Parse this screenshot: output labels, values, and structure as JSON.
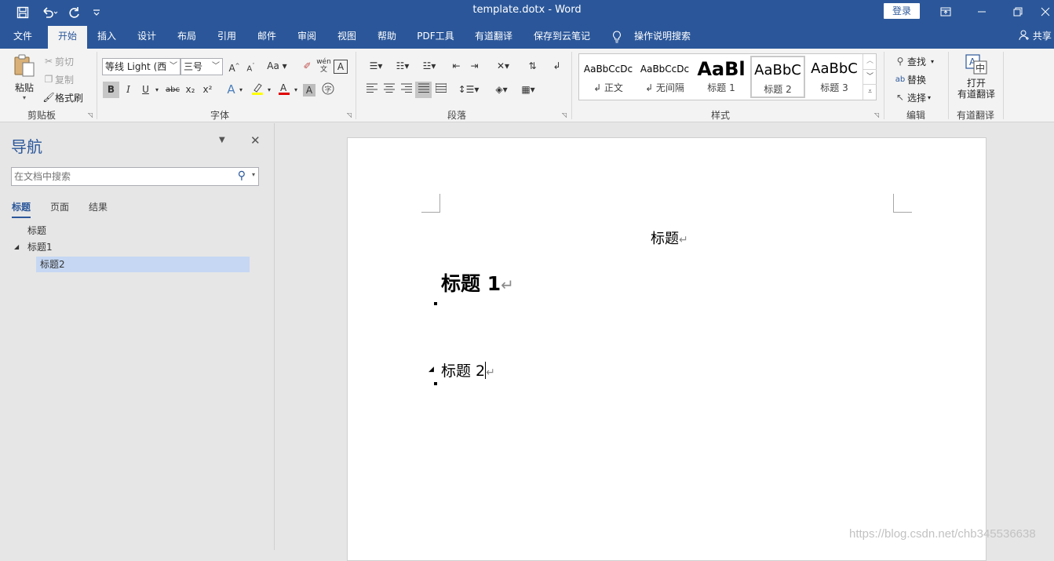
{
  "titlebar": {
    "doc_title": "template.dotx  -  Word",
    "login": "登录",
    "qat": {
      "save_icon": "save-icon",
      "undo_icon": "undo-icon",
      "redo_icon": "redo-icon",
      "customize_icon": "customize-qat-icon"
    },
    "window": {
      "ribbon_display_icon": "ribbon-display-icon",
      "minimize_icon": "minimize-icon",
      "restore_icon": "restore-icon",
      "close_icon": "close-icon"
    }
  },
  "tabs": [
    "文件",
    "开始",
    "插入",
    "设计",
    "布局",
    "引用",
    "邮件",
    "审阅",
    "视图",
    "帮助",
    "PDF工具",
    "有道翻译",
    "保存到云笔记"
  ],
  "active_tab": "开始",
  "tell_me": "操作说明搜索",
  "share": "共享",
  "ribbon": {
    "clipboard": {
      "paste": "粘贴",
      "cut": "剪切",
      "copy": "复制",
      "format_painter": "格式刷",
      "label": "剪贴板"
    },
    "font": {
      "font_name": "等线 Light (西",
      "font_size": "三号",
      "bold": "B",
      "italic": "I",
      "underline": "U",
      "strike": "abc",
      "sub": "x₂",
      "sup": "x²",
      "case": "Aa",
      "phonetic": "wén",
      "label": "字体"
    },
    "paragraph": {
      "label": "段落"
    },
    "styles": {
      "items": [
        {
          "preview": "AaBbCcDc",
          "name": "↲ 正文"
        },
        {
          "preview": "AaBbCcDc",
          "name": "↲ 无间隔"
        },
        {
          "preview": "AaBl",
          "name": "标题 1"
        },
        {
          "preview": "AaBbC",
          "name": "标题 2"
        },
        {
          "preview": "AaBbC",
          "name": "标题 3"
        }
      ],
      "selected_index": 3,
      "label": "样式"
    },
    "editing": {
      "find": "查找",
      "replace": "替换",
      "select": "选择",
      "label": "编辑"
    },
    "youdao": {
      "open_line1": "打开",
      "open_line2": "有道翻译",
      "label": "有道翻译"
    }
  },
  "nav": {
    "title": "导航",
    "search_placeholder": "在文档中搜索",
    "tabs": [
      "标题",
      "页面",
      "结果"
    ],
    "active_tab": "标题",
    "tree": [
      {
        "label": "标题",
        "level": 0,
        "expander": ""
      },
      {
        "label": "标题1",
        "level": 0,
        "expander": "◢"
      },
      {
        "label": "标题2",
        "level": 1,
        "expander": "",
        "selected": true
      }
    ]
  },
  "document": {
    "title": "标题",
    "heading1": "标题 1",
    "heading2": "标题 2",
    "para_mark": "↵"
  },
  "watermark": "https://blog.csdn.net/chb345536638"
}
